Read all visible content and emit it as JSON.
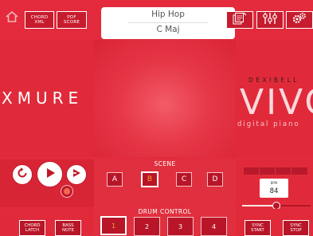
{
  "header": {
    "chord_xml_label": "CHORD XML",
    "pdf_score_label": "PDF SCORE",
    "style_name": "Hip Hop",
    "key": "C Maj",
    "icons": [
      "home-icon",
      "chord-edit-icon",
      "mixer-icon",
      "settings-icon"
    ]
  },
  "logos": {
    "left": "XMURE",
    "right_brand": "DEXIBELL",
    "right_model": "VIVO",
    "right_tagline": "digital piano"
  },
  "transport": {
    "icons": [
      "rewind-icon",
      "play-icon",
      "forward-icon",
      "record-icon"
    ]
  },
  "scene": {
    "title": "SCENE",
    "buttons": [
      "A",
      "B",
      "C",
      "D"
    ],
    "active": "B"
  },
  "tempo": {
    "bpm_label": "BPM",
    "bpm_value": "84"
  },
  "drum_control": {
    "title": "DRUM CONTROL",
    "buttons": [
      "1",
      "2",
      "3",
      "4"
    ],
    "active": "1"
  },
  "bottom": {
    "chord_latch_label": "CHORD LATCH",
    "bass_note_label": "BASS NOTE",
    "sync_start_label": "SYNC START",
    "sync_stop_label": "SYNC STOP"
  },
  "colors": {
    "background": "#e22b3c",
    "button_fill": "#b81628",
    "active_text": "#f4a531",
    "panel_white": "#ffffff"
  }
}
